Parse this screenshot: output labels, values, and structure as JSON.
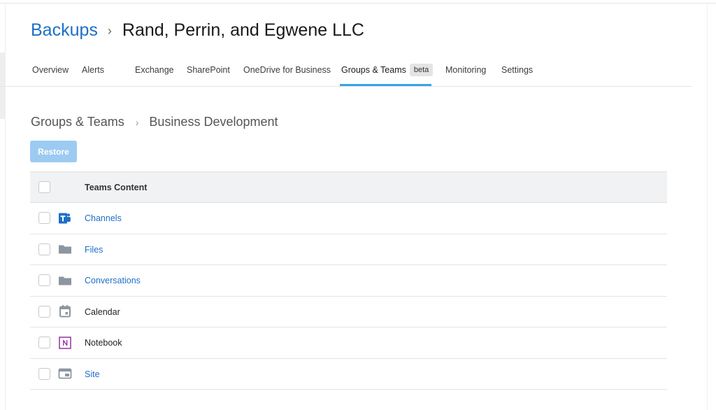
{
  "header": {
    "breadcrumb_root": "Backups",
    "breadcrumb_separator": "›",
    "title": "Rand, Perrin, and Egwene LLC"
  },
  "tabs": [
    {
      "label": "Overview"
    },
    {
      "label": "Alerts"
    },
    {
      "label": "Exchange"
    },
    {
      "label": "SharePoint"
    },
    {
      "label": "OneDrive for Business"
    },
    {
      "label": "Groups & Teams",
      "badge": "beta",
      "active": true
    },
    {
      "label": "Monitoring"
    },
    {
      "label": "Settings"
    }
  ],
  "sub_breadcrumb": {
    "parent": "Groups & Teams",
    "separator": "›",
    "current": "Business Development"
  },
  "toolbar": {
    "restore_label": "Restore"
  },
  "table": {
    "header": "Teams Content",
    "rows": [
      {
        "label": "Channels",
        "icon": "teams-icon",
        "link": true
      },
      {
        "label": "Files",
        "icon": "folder-icon",
        "link": true
      },
      {
        "label": "Conversations",
        "icon": "folder-icon",
        "link": true
      },
      {
        "label": "Calendar",
        "icon": "calendar-icon",
        "link": false
      },
      {
        "label": "Notebook",
        "icon": "onenote-icon",
        "link": false
      },
      {
        "label": "Site",
        "icon": "site-icon",
        "link": true
      }
    ]
  },
  "colors": {
    "accent": "#1e6fc8",
    "tab_underline": "#33a6e8",
    "restore_disabled": "#9ccbf1",
    "header_bg": "#f1f2f4",
    "teams_icon": "#1e6fc8",
    "onenote_icon": "#9b3fa6",
    "muted_icon": "#8c96a0"
  }
}
